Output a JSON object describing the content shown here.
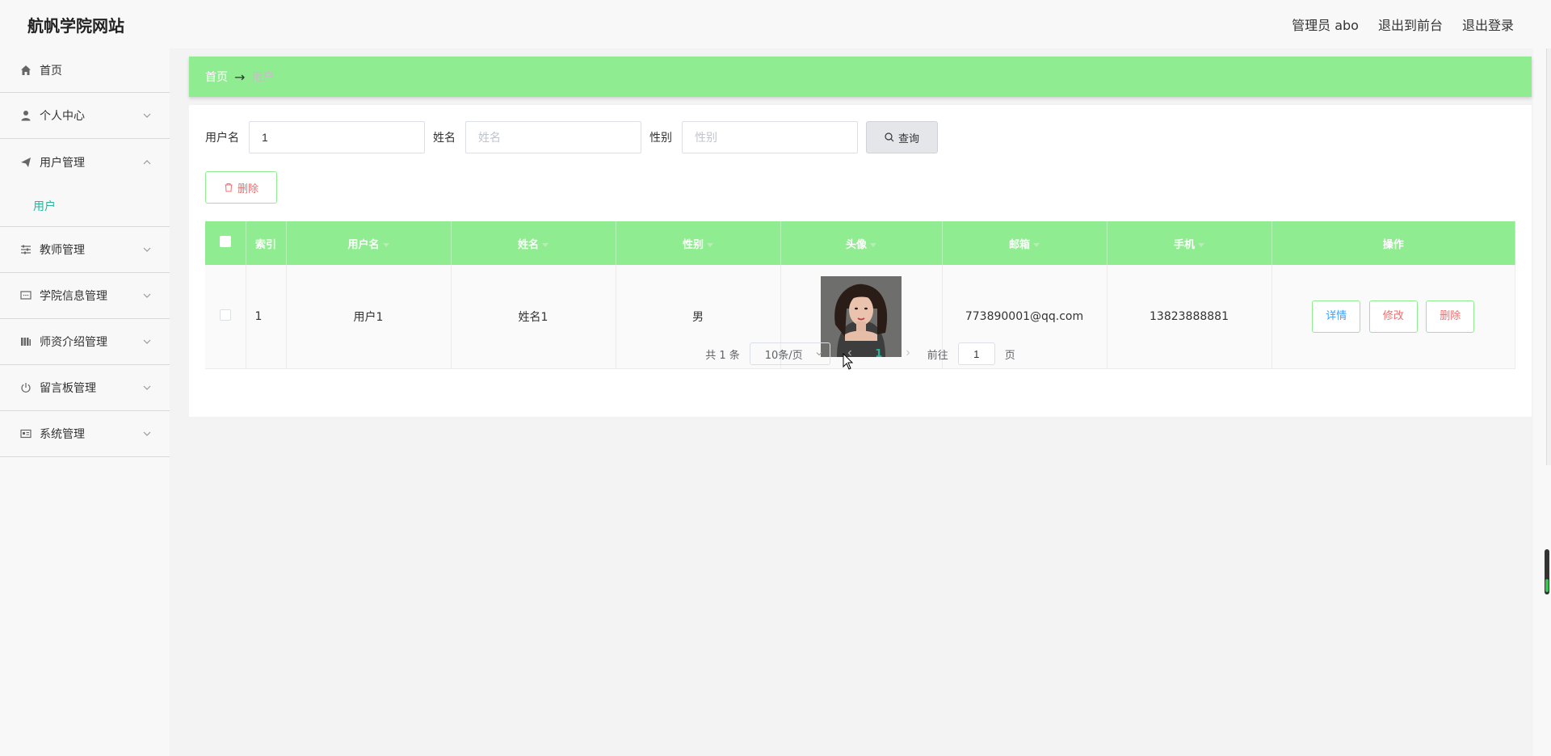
{
  "header": {
    "brand": "航帆学院网站",
    "admin": "管理员 abo",
    "to_frontend": "退出到前台",
    "logout": "退出登录"
  },
  "sidebar": {
    "items": [
      {
        "label": "首页",
        "icon": "home-icon"
      },
      {
        "label": "个人中心",
        "icon": "user-icon"
      },
      {
        "label": "用户管理",
        "icon": "paper-plane-icon",
        "expanded": true,
        "children": [
          "用户"
        ]
      },
      {
        "label": "教师管理",
        "icon": "sliders-icon"
      },
      {
        "label": "学院信息管理",
        "icon": "chat-icon"
      },
      {
        "label": "师资介绍管理",
        "icon": "bars-icon"
      },
      {
        "label": "留言板管理",
        "icon": "power-icon"
      },
      {
        "label": "系统管理",
        "icon": "id-card-icon"
      }
    ]
  },
  "breadcrumb": {
    "home": "首页",
    "separator": "→",
    "current": "用户"
  },
  "search": {
    "username_label": "用户名",
    "username_value": "1",
    "name_label": "姓名",
    "name_placeholder": "姓名",
    "gender_label": "性别",
    "gender_placeholder": "性别",
    "button": "查询"
  },
  "actions": {
    "delete": "删除"
  },
  "table": {
    "headers": [
      "索引",
      "用户名",
      "姓名",
      "性别",
      "头像",
      "邮箱",
      "手机",
      "操作"
    ],
    "rows": [
      {
        "index": "1",
        "username": "用户1",
        "name": "姓名1",
        "gender": "男",
        "email": "773890001@qq.com",
        "phone": "13823888881"
      }
    ],
    "row_actions": {
      "detail": "详情",
      "edit": "修改",
      "delete": "删除"
    }
  },
  "pagination": {
    "total": "共 1 条",
    "page_size": "10条/页",
    "current_page": "1",
    "goto_label": "前往",
    "goto_value": "1",
    "page_suffix": "页"
  },
  "colors": {
    "accent": "#90ec90",
    "active": "#2bb39a",
    "danger": "#f56c6c",
    "info": "#409eff"
  }
}
